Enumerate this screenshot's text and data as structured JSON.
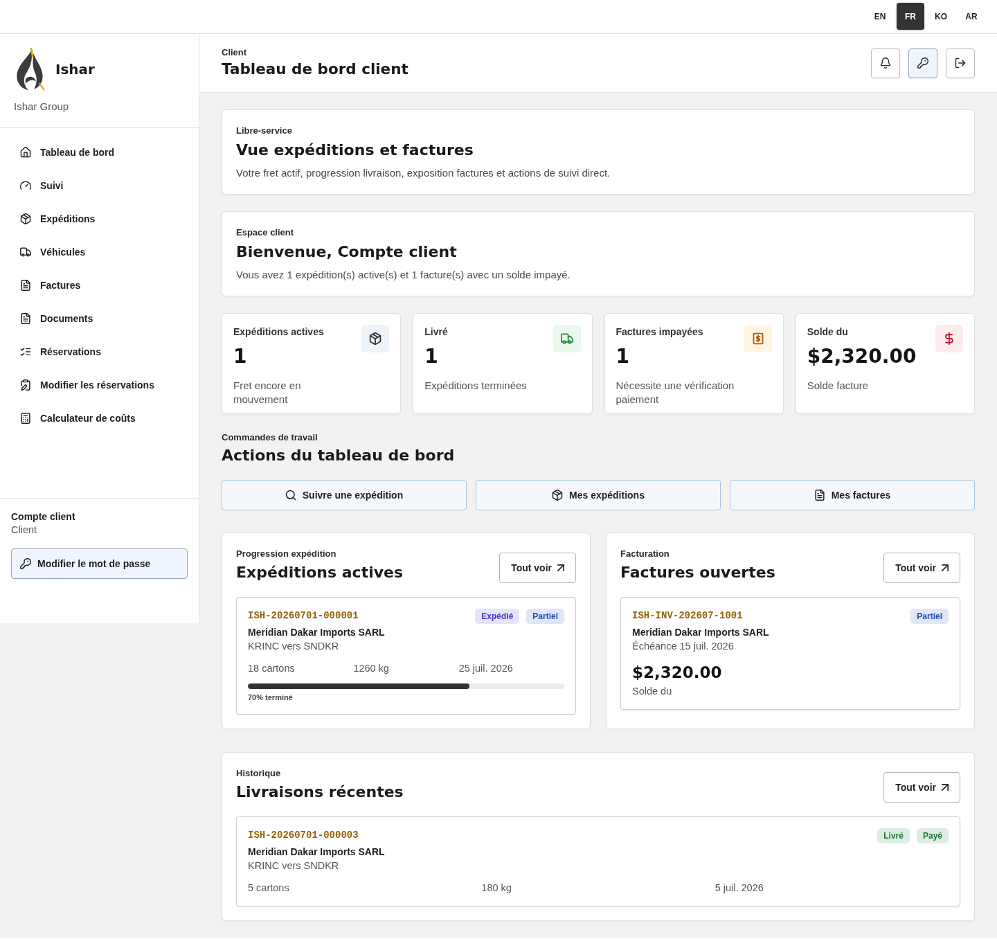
{
  "top_bar": {
    "languages": [
      {
        "label": "EN",
        "selected": false
      },
      {
        "label": "FR",
        "selected": true
      },
      {
        "label": "KO",
        "selected": false
      },
      {
        "label": "AR",
        "selected": false
      }
    ]
  },
  "sidebar": {
    "brand": "Ishar",
    "subtitle": "Ishar Group",
    "nav": [
      "Tableau de bord",
      "Suivi",
      "Expéditions",
      "Véhicules",
      "Factures",
      "Documents",
      "Réservations",
      "Modifier les réservations",
      "Calculateur de coûts"
    ],
    "account": {
      "name": "Compte client",
      "role": "Client",
      "button": "Modifier le mot de passe"
    }
  },
  "header": {
    "eyebrow": "Client",
    "title": "Tableau de bord client",
    "actions": [
      {
        "selected": false
      },
      {
        "selected": true
      },
      {
        "selected": false
      }
    ]
  },
  "intro": {
    "eyebrow": "Libre-service",
    "title": "Vue expéditions et factures",
    "description": "Votre fret actif, progression livraison, exposition factures et actions de suivi direct."
  },
  "welcome": {
    "eyebrow": "Espace client",
    "title": "Bienvenue, Compte client",
    "description": "Vous avez 1 expédition(s) active(s) et 1 facture(s) avec un solde impayé."
  },
  "stats": [
    {
      "label": "Expéditions actives",
      "value": "1",
      "note": "Fret encore en mouvement",
      "color": "#eef3f9"
    },
    {
      "label": "Livré",
      "value": "1",
      "note": "Expéditions terminées",
      "color": "#eaf8ee"
    },
    {
      "label": "Factures impayées",
      "value": "1",
      "note": "Nécessite une vérification paiement",
      "color": "#fff6e0"
    },
    {
      "label": "Solde du",
      "value": "$2,320.00",
      "note": "Solde facture",
      "color": "#fdecee"
    }
  ],
  "work_orders": {
    "eyebrow": "Commandes de travail",
    "title": "Actions du tableau de bord",
    "buttons": [
      "Suivre une expédition",
      "Mes expéditions",
      "Mes factures"
    ]
  },
  "shipments_panel": {
    "eyebrow": "Progression expédition",
    "title": "Expéditions actives",
    "link": "Tout voir",
    "items": [
      {
        "reference": "ISH-20260701-000001",
        "customer": "Meridian Dakar Imports SARL",
        "route": "KRINC vers SNDKR",
        "cartons": "18 cartons",
        "weight": "1260 kg",
        "date": "25 juil. 2026",
        "badges": [
          {
            "label": "Expédié",
            "color": "#4338ca"
          },
          {
            "label": "Partiel",
            "color": "#1f4fb5"
          }
        ],
        "level": 0.7,
        "progress_label": "70% terminé"
      }
    ]
  },
  "invoices_panel": {
    "eyebrow": "Facturation",
    "title": "Factures ouvertes",
    "link": "Tout voir",
    "items": [
      {
        "reference": "ISH-INV-202607-1001",
        "customer": "Meridian Dakar Imports SARL",
        "due": "Échéance 15 juil. 2026",
        "amount": "$2,320.00",
        "amount_label": "Solde du",
        "badges": [
          {
            "label": "Partiel",
            "color": "#1f4fb5"
          }
        ]
      }
    ]
  },
  "recent_deliveries": {
    "eyebrow": "Historique",
    "title": "Livraisons récentes",
    "link": "Tout voir",
    "items": [
      {
        "reference": "ISH-20260701-000003",
        "customer": "Meridian Dakar Imports SARL",
        "route": "KRINC vers SNDKR",
        "cartons": "5 cartons",
        "weight": "180 kg",
        "date": "5 juil. 2026",
        "badges": [
          {
            "label": "Livré",
            "color": "#177a34"
          },
          {
            "label": "Payé",
            "color": "#177a34"
          }
        ]
      }
    ]
  }
}
